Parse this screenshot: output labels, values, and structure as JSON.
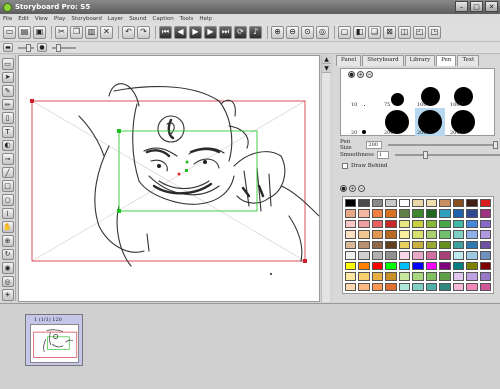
{
  "window": {
    "title": "Storyboard Pro: S5"
  },
  "menu": [
    "File",
    "Edit",
    "View",
    "Play",
    "Storyboard",
    "Layer",
    "Sound",
    "Caption",
    "Tools",
    "Help"
  ],
  "right_panel": {
    "tabs": [
      "Panel",
      "Storyboard",
      "Library",
      "Pen",
      "Text"
    ],
    "active_tab": "Pen",
    "pens": [
      {
        "label": "10",
        "size": 1
      },
      {
        "label": "75",
        "size": 13
      },
      {
        "label": "100 T",
        "size": 19
      },
      {
        "label": "100 T",
        "size": 19
      },
      {
        "label": "20",
        "size": 4
      },
      {
        "label": "200",
        "size": 24
      },
      {
        "label": "200 T",
        "size": 24
      },
      {
        "label": "200 T",
        "size": 24
      }
    ],
    "selected_pen_index": 6,
    "pen_size_label": "Pen Size",
    "pen_size_value": "200",
    "smoothness_label": "Smoothness",
    "smoothness_value": "1",
    "draw_behind_label": "Draw Behind"
  },
  "palette": [
    "#000000",
    "#4a4a4a",
    "#8a8a8a",
    "#c8c8c8",
    "#ffffff",
    "#e8d8a8",
    "#f0e0b0",
    "#c89060",
    "#8a5020",
    "#402010",
    "#d82020",
    "#e8a888",
    "#f4b8a0",
    "#f08040",
    "#d87020",
    "#608048",
    "#408830",
    "#206820",
    "#30a0c0",
    "#2060b0",
    "#304890",
    "#a03080",
    "#f8c8c8",
    "#f0a0a0",
    "#e86060",
    "#c82828",
    "#e8e880",
    "#c8d040",
    "#88b838",
    "#48a848",
    "#40b8a8",
    "#4888d8",
    "#8868c8",
    "#f8e0c0",
    "#f0c890",
    "#e09850",
    "#b86820",
    "#f8f0a0",
    "#d8e070",
    "#a8d070",
    "#70c070",
    "#80d0c8",
    "#90b0e8",
    "#b098e0",
    "#d8b898",
    "#b89070",
    "#906848",
    "#604020",
    "#e8d060",
    "#c8b040",
    "#98a830",
    "#689020",
    "#40a0a0",
    "#3078b0",
    "#7050a0",
    "#f0f0f0",
    "#d0d0d0",
    "#b0b0b0",
    "#909090",
    "#f8d8e8",
    "#e8a8c8",
    "#d070a0",
    "#a84078",
    "#c0e8f0",
    "#a0c8e0",
    "#7090c0",
    "#ffff00",
    "#ff8000",
    "#ff0000",
    "#00ff00",
    "#00c0ff",
    "#0000ff",
    "#ff00ff",
    "#800080",
    "#008080",
    "#808000",
    "#800000",
    "#fce8a0",
    "#f8d070",
    "#e8b040",
    "#c89028",
    "#c8e8a0",
    "#a8d880",
    "#80c060",
    "#60a048",
    "#e0c8f0",
    "#c0a0e0",
    "#9878c8",
    "#ffd8b0",
    "#ffb880",
    "#ff9850",
    "#e07030",
    "#b0e8e0",
    "#80d0c8",
    "#50b0a8",
    "#308880",
    "#f8b8d8",
    "#f088b8",
    "#d05898"
  ],
  "timeline": {
    "panel_label": "1  (1/1)  120"
  }
}
